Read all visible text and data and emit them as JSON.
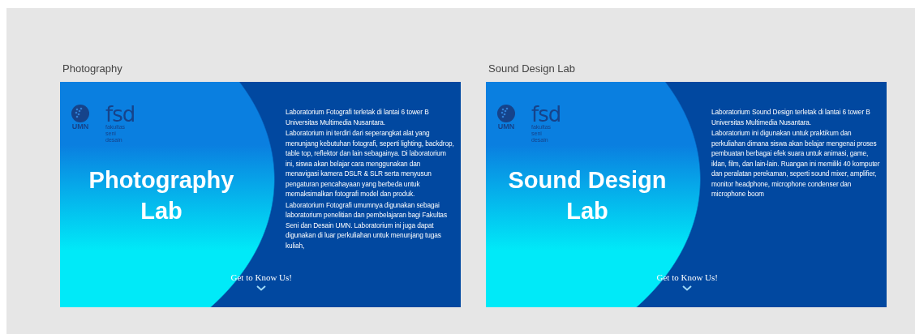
{
  "labs": [
    {
      "label": "Photography",
      "logo": {
        "umn": "UMN",
        "fsd": "fsd",
        "fsd_caption": [
          "fakultas",
          "seni",
          "desain"
        ]
      },
      "title": "Photography Lab",
      "paragraphs": [
        "Laboratorium Fotografi terletak di lantai 6 tower B Universitas Multimedia Nusantara.",
        "Laboratorium ini terdiri dari seperangkat alat yang menunjang kebutuhan fotografi, seperti lighting, backdrop, table top, reflektor dan lain sebagainya. Di laboratorium ini, siswa akan belajar cara menggunakan dan menavigasi kamera DSLR & SLR serta menyusun pengaturan pencahayaan yang berbeda untuk memaksimalkan fotografi model dan produk.",
        "Laboratorium Fotografi umumnya digunakan sebagai laboratorium penelitian dan pembelajaran bagi Fakultas Seni dan Desain UMN. Laboratorium ini juga dapat digunakan di luar perkuliahan untuk menunjang tugas kuliah,"
      ],
      "cta": "Get to Know Us!"
    },
    {
      "label": "Sound Design Lab",
      "logo": {
        "umn": "UMN",
        "fsd": "fsd",
        "fsd_caption": [
          "fakultas",
          "seni",
          "desain"
        ]
      },
      "title": "Sound Design Lab",
      "paragraphs": [
        "Laboratorium Sound Design terletak di lantai 6 tower B Universitas Multimedia Nusantara.",
        "Laboratorium ini digunakan untuk praktikum dan perkuliahan dimana siswa akan belajar mengenai proses pembuatan berbagai efek suara untuk animasi, game, iklan, film, dan lain-lain. Ruangan ini memiliki 40 komputer dan peralatan perekaman, seperti sound mixer, amplifier, monitor headphone, microphone condenser dan microphone boom"
      ],
      "cta": "Get to Know Us!"
    }
  ]
}
